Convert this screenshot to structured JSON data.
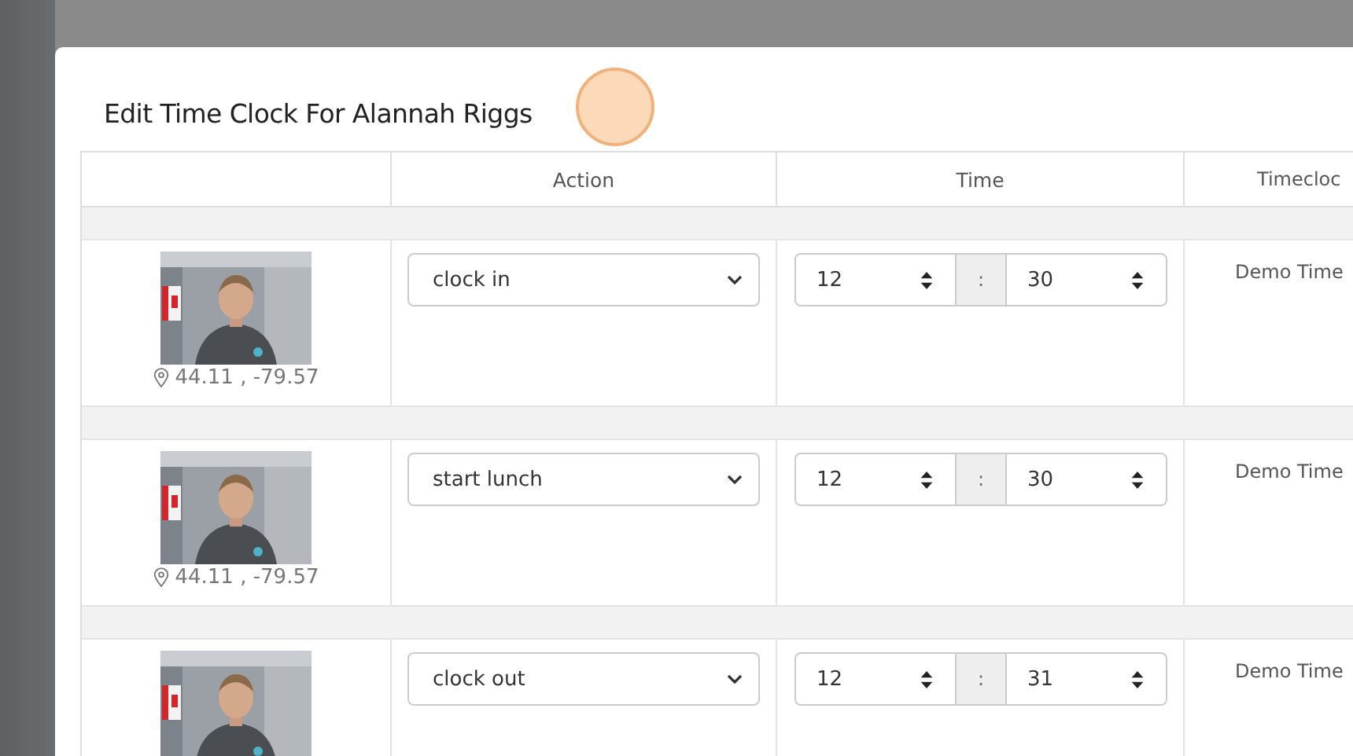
{
  "dialog": {
    "title": "Edit Time Clock For Alannah Riggs"
  },
  "table": {
    "columns": [
      "Action",
      "Time",
      "Timecloc"
    ],
    "rows": [
      {
        "location": "44.11 , -79.57",
        "action": "clock in",
        "hour": "12",
        "separator": ":",
        "minute": "30",
        "timeclock": "Demo Time"
      },
      {
        "location": "44.11 , -79.57",
        "action": "start lunch",
        "hour": "12",
        "separator": ":",
        "minute": "30",
        "timeclock": "Demo Time"
      },
      {
        "action": "clock out",
        "hour": "12",
        "separator": ":",
        "minute": "31",
        "timeclock": "Demo Time"
      }
    ]
  }
}
